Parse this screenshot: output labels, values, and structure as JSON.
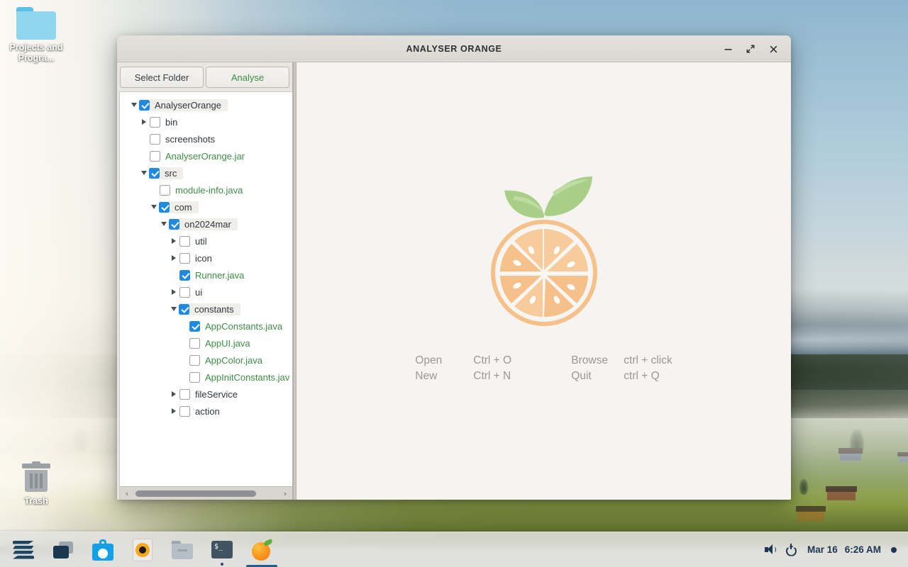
{
  "desktop": {
    "icons": [
      {
        "name": "projects-folder",
        "label": "Projects and Progra...",
        "icon": "folder-icon"
      },
      {
        "name": "trash",
        "label": "Trash",
        "icon": "trash-icon"
      }
    ]
  },
  "window": {
    "title": "ANALYSER ORANGE",
    "controls": {
      "minimize": "−",
      "maximize": "⤡",
      "close": "×"
    }
  },
  "toolbar": {
    "select_folder_label": "Select Folder",
    "analyse_label": "Analyse",
    "accent_color": "#3c8f42"
  },
  "tree": {
    "rows": [
      {
        "depth": 0,
        "twisty": "down",
        "checked": true,
        "label": "AnalyserOrange",
        "kind": "folder",
        "selected": true
      },
      {
        "depth": 1,
        "twisty": "right",
        "checked": false,
        "label": "bin",
        "kind": "folder",
        "selected": false
      },
      {
        "depth": 1,
        "twisty": "none",
        "checked": false,
        "label": "screenshots",
        "kind": "folder",
        "selected": false
      },
      {
        "depth": 1,
        "twisty": "none",
        "checked": false,
        "label": "AnalyserOrange.jar",
        "kind": "file",
        "selected": false
      },
      {
        "depth": 1,
        "twisty": "down",
        "checked": true,
        "label": "src",
        "kind": "folder",
        "selected": true
      },
      {
        "depth": 2,
        "twisty": "none",
        "checked": false,
        "label": "module-info.java",
        "kind": "file",
        "selected": false
      },
      {
        "depth": 2,
        "twisty": "down",
        "checked": true,
        "label": "com",
        "kind": "folder",
        "selected": true
      },
      {
        "depth": 3,
        "twisty": "down",
        "checked": true,
        "label": "on2024mar",
        "kind": "folder",
        "selected": true
      },
      {
        "depth": 4,
        "twisty": "right",
        "checked": false,
        "label": "util",
        "kind": "folder",
        "selected": false
      },
      {
        "depth": 4,
        "twisty": "right",
        "checked": false,
        "label": "icon",
        "kind": "folder",
        "selected": false
      },
      {
        "depth": 4,
        "twisty": "none",
        "checked": true,
        "label": "Runner.java",
        "kind": "file",
        "selected": false
      },
      {
        "depth": 4,
        "twisty": "right",
        "checked": false,
        "label": "ui",
        "kind": "folder",
        "selected": false
      },
      {
        "depth": 4,
        "twisty": "down",
        "checked": true,
        "label": "constants",
        "kind": "folder",
        "selected": true
      },
      {
        "depth": 5,
        "twisty": "none",
        "checked": true,
        "label": "AppConstants.java",
        "kind": "file",
        "selected": false
      },
      {
        "depth": 5,
        "twisty": "none",
        "checked": false,
        "label": "AppUI.java",
        "kind": "file",
        "selected": false
      },
      {
        "depth": 5,
        "twisty": "none",
        "checked": false,
        "label": "AppColor.java",
        "kind": "file",
        "selected": false
      },
      {
        "depth": 5,
        "twisty": "none",
        "checked": false,
        "label": "AppInitConstants.jav",
        "kind": "file",
        "selected": false
      },
      {
        "depth": 4,
        "twisty": "right",
        "checked": false,
        "label": "fileService",
        "kind": "folder",
        "selected": false
      },
      {
        "depth": 4,
        "twisty": "right",
        "checked": false,
        "label": "action",
        "kind": "folder",
        "selected": false
      }
    ],
    "file_text_color": "#3d8f43",
    "folder_text_color": "#32373c",
    "checkbox_color": "#1f8ae0"
  },
  "scrollbar": {
    "left_arrow": "‹",
    "right_arrow": "›"
  },
  "content": {
    "logo": "orange-slice-logo",
    "shortcuts": [
      {
        "action": "Open",
        "keys": "Ctrl + O",
        "action2": "Browse",
        "keys2": "ctrl + click"
      },
      {
        "action": "New",
        "keys": "Ctrl + N",
        "action2": "Quit",
        "keys2": "ctrl + Q"
      }
    ]
  },
  "taskbar": {
    "apps": [
      {
        "name": "zorin-menu-icon",
        "active": false
      },
      {
        "name": "task-view-icon",
        "active": false
      },
      {
        "name": "software-store-icon",
        "active": false
      },
      {
        "name": "music-player-icon",
        "active": false
      },
      {
        "name": "files-icon",
        "active": false
      },
      {
        "name": "terminal-icon",
        "active": false,
        "dot": true
      },
      {
        "name": "analyser-orange-icon",
        "active": true
      }
    ],
    "date": "Mar 16",
    "time": "6:26 AM"
  }
}
